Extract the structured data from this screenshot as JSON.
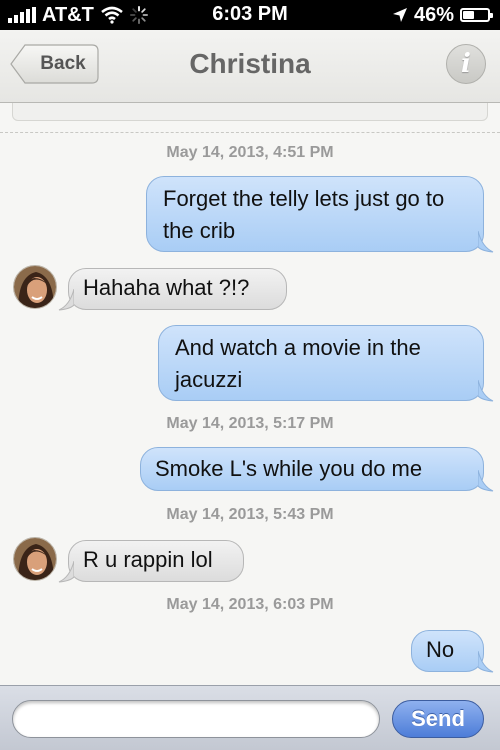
{
  "status_bar": {
    "carrier": "AT&T",
    "time": "6:03 PM",
    "battery_percent": "46%",
    "battery_level": 0.46,
    "icons": [
      "signal-bars-icon",
      "wifi-icon",
      "activity-spinner-icon",
      "location-arrow-icon",
      "battery-icon"
    ]
  },
  "nav": {
    "back_label": "Back",
    "title": "Christina",
    "info_icon": "i"
  },
  "thread": {
    "timestamps": [
      "May 14, 2013, 4:51 PM",
      "May 14, 2013, 5:17 PM",
      "May 14, 2013, 5:43 PM",
      "May 14, 2013, 6:03 PM"
    ],
    "messages": [
      {
        "direction": "sent",
        "text": "Forget the telly lets just go to the crib"
      },
      {
        "direction": "received",
        "text": "Hahaha what ?!?"
      },
      {
        "direction": "sent",
        "text": "And watch a movie in the jacuzzi"
      },
      {
        "direction": "sent",
        "text": "Smoke L's while you do me"
      },
      {
        "direction": "received",
        "text": "R u rappin lol"
      },
      {
        "direction": "sent",
        "text": "No"
      }
    ]
  },
  "composer": {
    "input_value": "",
    "placeholder": "",
    "send_label": "Send"
  },
  "colors": {
    "sent_bubble": "#b8d6f8",
    "received_bubble": "#e6e6e6",
    "send_button": "#5b88dd",
    "timestamp_text": "#9a9a9a"
  }
}
